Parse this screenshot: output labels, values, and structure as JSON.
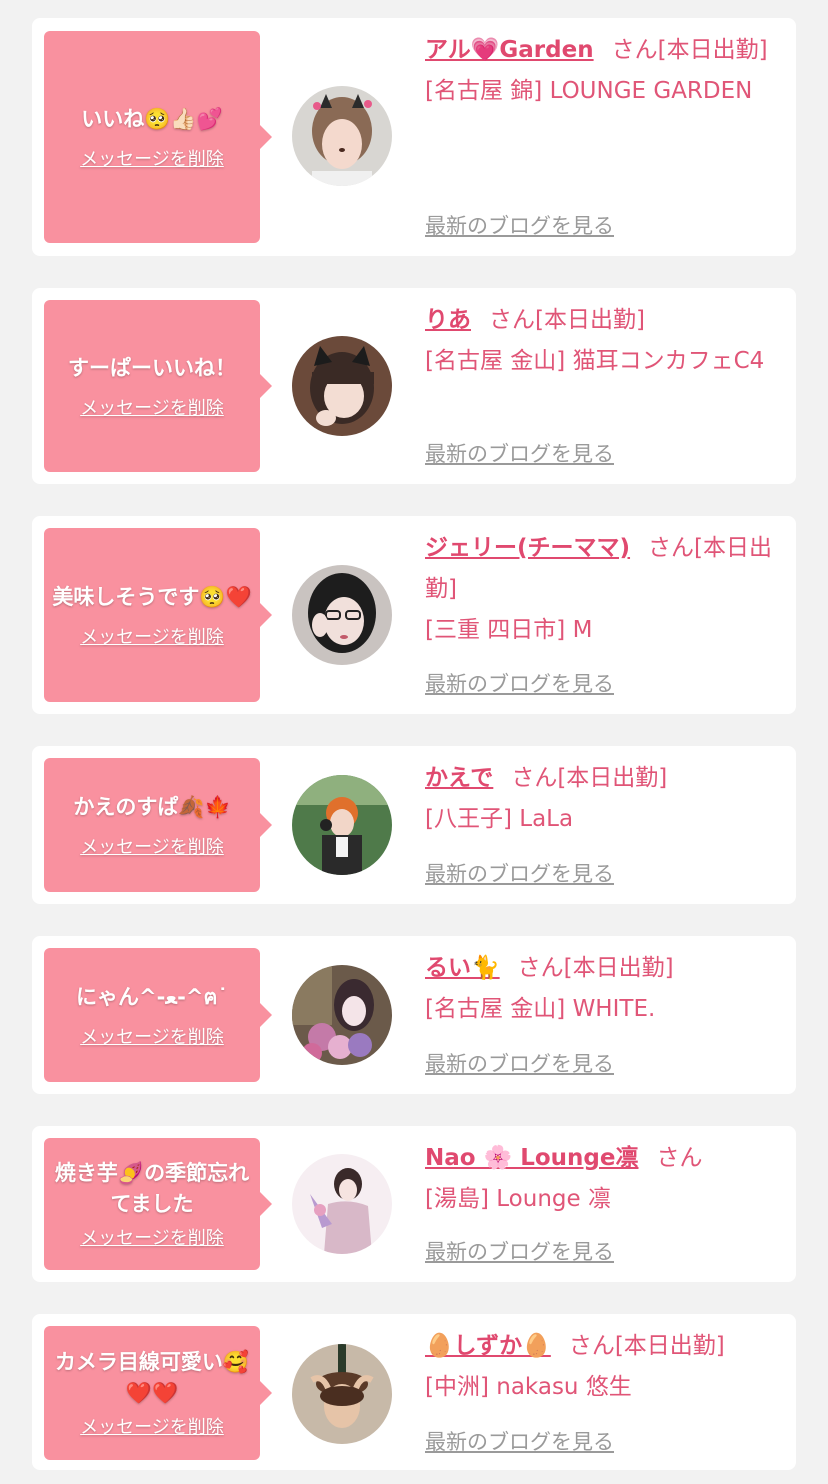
{
  "delete_label": "メッセージを削除",
  "blog_label": "最新のブログを見る",
  "san_label": "さん",
  "colors": {
    "background": "#f2f2f2",
    "bubble": "#f9919f",
    "name": "#e0496f",
    "info": "#e05577",
    "blog_link": "#9a9a9a"
  },
  "items": [
    {
      "message": "いいね🥺👍🏻💕",
      "name": "アル💗Garden",
      "status": "[本日出勤]",
      "shop": "[名古屋 錦] LOUNGE GARDEN",
      "avatar_icon": "profile-photo-girl-cat-ears"
    },
    {
      "message": "すーぱーいいね！",
      "name": "りあ",
      "status": "[本日出勤]",
      "shop": "[名古屋 金山] 猫耳コンカフェC4",
      "avatar_icon": "profile-photo-girl-cat-ears"
    },
    {
      "message": "美味しそうです🥺❤️",
      "name": "ジェリー(チーママ)",
      "status": "[本日出勤]",
      "shop": "[三重 四日市] M",
      "avatar_icon": "profile-photo-woman-glasses"
    },
    {
      "message": "かえのすぱ🍂🍁",
      "name": "かえで",
      "status": "[本日出勤]",
      "shop": "[八王子] LaLa",
      "avatar_icon": "profile-photo-costume"
    },
    {
      "message": "にゃん^-ﻌ-^ฅ˙",
      "name": "るい🐈",
      "status": "[本日出勤]",
      "shop": "[名古屋 金山] WHITE.",
      "avatar_icon": "profile-photo-flowers"
    },
    {
      "message": "焼き芋🍠の季節忘れてました",
      "name": "Nao 🌸 Lounge凛",
      "status": "",
      "shop": "[湯島] Lounge 凛",
      "avatar_icon": "profile-photo-kimono"
    },
    {
      "message": "カメラ目線可愛い🥰❤️❤️",
      "name": "🥚しずか🥚",
      "status": "[本日出勤]",
      "shop": "[中洲] nakasu 悠生",
      "avatar_icon": "profile-photo-champagne"
    }
  ]
}
